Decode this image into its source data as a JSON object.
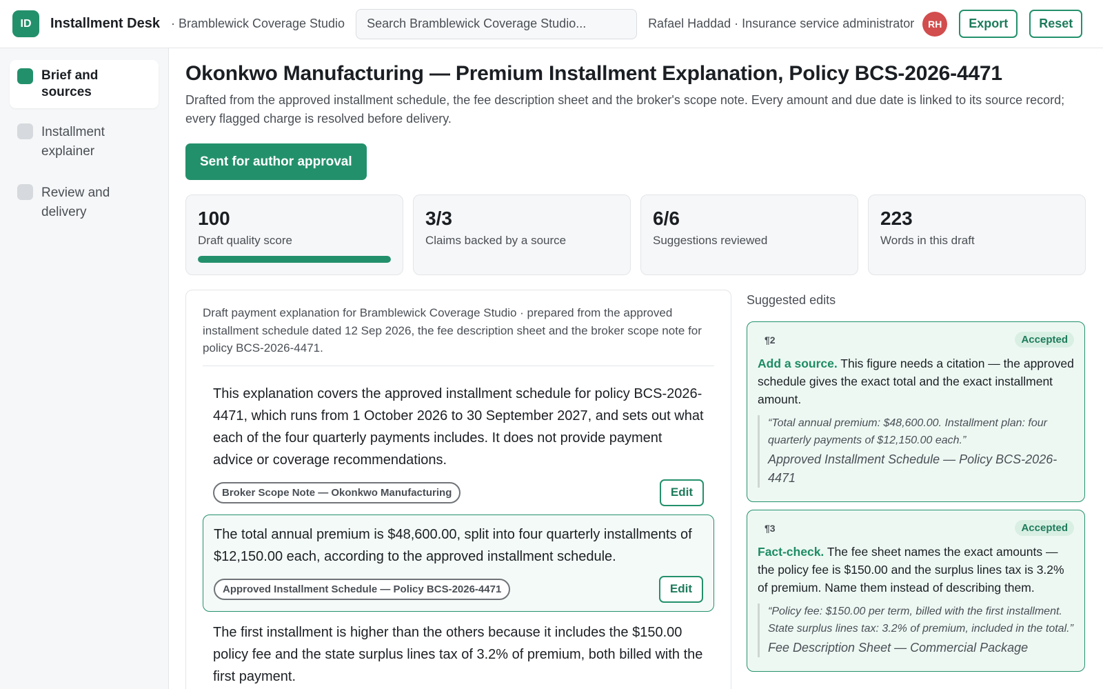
{
  "app": {
    "logo": "ID",
    "title": "Installment Desk",
    "org": "· Bramblewick Coverage Studio",
    "search_placeholder": "Search Bramblewick Coverage Studio...",
    "user": "Rafael Haddad · Insurance service administrator",
    "avatar": "RH",
    "export_label": "Export",
    "reset_label": "Reset"
  },
  "sidebar": {
    "items": [
      {
        "label": "Brief and sources",
        "active": true
      },
      {
        "label": "Installment explainer",
        "active": false
      },
      {
        "label": "Review and delivery",
        "active": false
      }
    ]
  },
  "page": {
    "title": "Okonkwo Manufacturing — Premium Installment Explanation, Policy BCS-2026-4471",
    "subtitle": "Drafted from the approved installment schedule, the fee description sheet and the broker's scope note. Every amount and due date is linked to its source record; every flagged charge is resolved before delivery.",
    "status_button": "Sent for author approval"
  },
  "stats": [
    {
      "value": "100",
      "label": "Draft quality score",
      "progress": 1.0
    },
    {
      "value": "3/3",
      "label": "Claims backed by a source"
    },
    {
      "value": "6/6",
      "label": "Suggestions reviewed"
    },
    {
      "value": "223",
      "label": "Words in this draft"
    }
  ],
  "draft": {
    "header": "Draft payment explanation for Bramblewick Coverage Studio · prepared from the approved installment schedule dated 12 Sep 2026, the fee description sheet and the broker scope note for policy BCS-2026-4471.",
    "edit_label": "Edit",
    "paragraphs": [
      {
        "text": "This explanation covers the approved installment schedule for policy BCS-2026-4471, which runs from 1 October 2026 to 30 September 2027, and sets out what each of the four quarterly payments includes. It does not provide payment advice or coverage recommendations.",
        "source": "Broker Scope Note — Okonkwo Manufacturing"
      },
      {
        "text": "The total annual premium is $48,600.00, split into four quarterly installments of $12,150.00 each, according to the approved installment schedule.",
        "source": "Approved Installment Schedule — Policy BCS-2026-4471"
      },
      {
        "text": "The first installment is higher than the others because it includes the $150.00 policy fee and the state surplus lines tax of 3.2% of premium, both billed with the first payment."
      }
    ]
  },
  "suggestions": {
    "title": "Suggested edits",
    "cards": [
      {
        "para": "¶2",
        "status": "Accepted",
        "kind": "Add a source.",
        "body": " This figure needs a citation — the approved schedule gives the exact total and the exact installment amount.",
        "quote": "“Total annual premium: $48,600.00. Installment plan: four quarterly payments of $12,150.00 each.”",
        "source": "Approved Installment Schedule — Policy BCS-2026-4471"
      },
      {
        "para": "¶3",
        "status": "Accepted",
        "kind": "Fact-check.",
        "body": " The fee sheet names the exact amounts — the policy fee is $150.00 and the surplus lines tax is 3.2% of premium. Name them instead of describing them.",
        "quote": "“Policy fee: $150.00 per term, billed with the first installment. State surplus lines tax: 3.2% of premium, included in the total.”",
        "source": "Fee Description Sheet — Commercial Package"
      }
    ]
  },
  "colors": {
    "accent": "#23906c",
    "avatar": "#d24d4d"
  }
}
